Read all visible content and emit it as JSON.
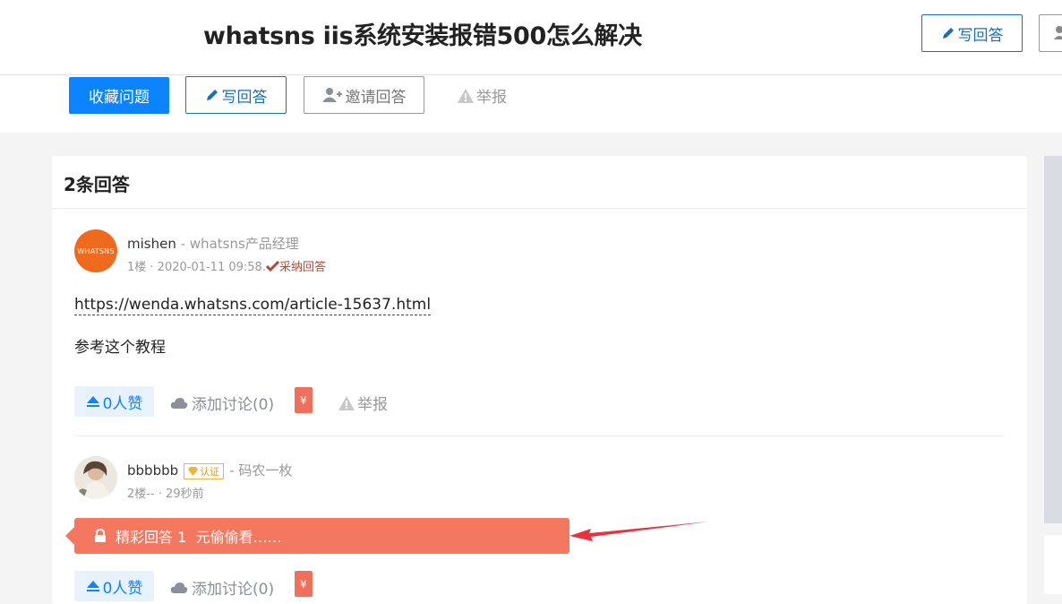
{
  "header": {
    "title": "whatsns iis系统安装报错500怎么解决",
    "write_answer_label": "写回答"
  },
  "actions": {
    "collect_label": "收藏问题",
    "write_answer_label": "写回答",
    "invite_label": "邀请回答",
    "report_label": "举报"
  },
  "answers_panel": {
    "title": "2条回答"
  },
  "answers": [
    {
      "avatar_text": "WHATSNS",
      "author": "mishen",
      "author_title": " - whatsns产品经理",
      "meta": "1楼 · 2020-01-11 09:58.",
      "accepted_label": "采纳回答",
      "link": "https://wenda.whatsns.com/article-15637.html",
      "text": "参考这个教程",
      "upvote_label": "0人赞",
      "discuss_label": "添加讨论(0)",
      "report_label": "举报",
      "redpacket_symbol": "¥"
    },
    {
      "author": "bbbbbb",
      "cert_label": "认证",
      "author_title": "- 码农一枚",
      "meta": "2楼-- · 29秒前",
      "locked_text": "精彩回答 1  元偷偷看……",
      "upvote_label": "0人赞",
      "discuss_label": "添加讨论(0)",
      "redpacket_symbol": "¥"
    }
  ],
  "colors": {
    "primary": "#0d84ff",
    "accent_outline": "#1c6fb6",
    "locked_bar": "#f47760",
    "avatar_orange": "#f06a1d",
    "arrow": "#e8323c"
  }
}
